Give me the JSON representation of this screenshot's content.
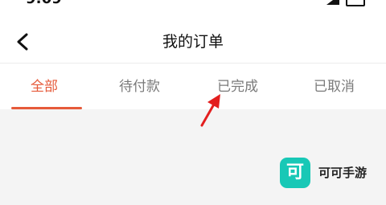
{
  "header": {
    "title": "我的订单"
  },
  "tabs": [
    {
      "label": "全部",
      "active": true
    },
    {
      "label": "待付款",
      "active": false
    },
    {
      "label": "已完成",
      "active": false
    },
    {
      "label": "已取消",
      "active": false
    }
  ],
  "annotation": {
    "arrow_color": "#e31e1e"
  },
  "watermark": {
    "logo_char": "可",
    "text": "可可手游",
    "logo_color": "#18c8b6"
  },
  "colors": {
    "accent": "#e65a3a",
    "tab_inactive": "#7a7a7a",
    "background": "#f4f4f4"
  }
}
